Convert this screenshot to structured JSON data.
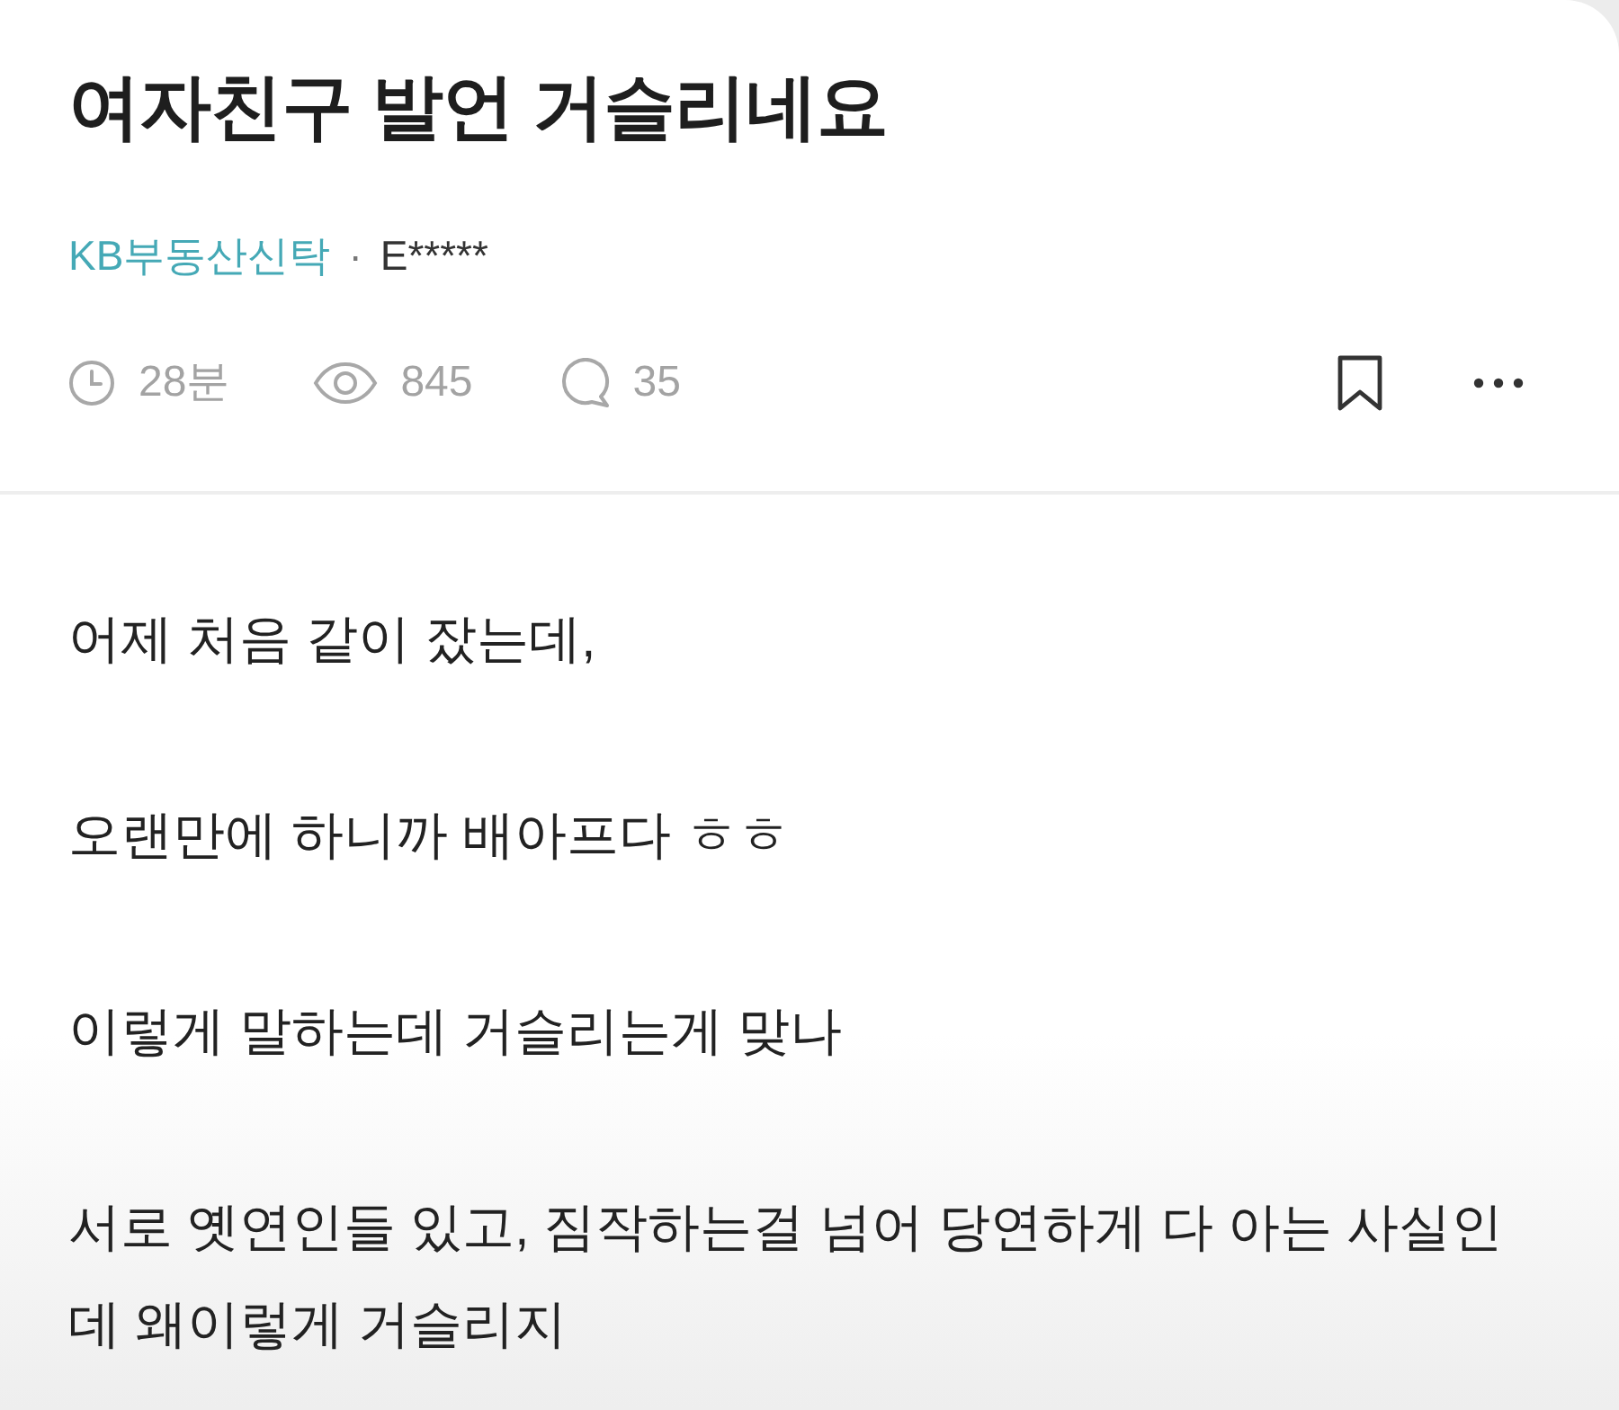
{
  "post": {
    "title": "여자친구 발언 거슬리네요",
    "board": "KB부동산신탁",
    "separator": "·",
    "author": "E*****",
    "stats": [
      {
        "kind": "time",
        "value": "28분"
      },
      {
        "kind": "views",
        "value": "845"
      },
      {
        "kind": "comments",
        "value": "35"
      }
    ],
    "bookmarked": false
  },
  "body": {
    "paragraphs": [
      "어제 처음 같이 잤는데,",
      "오랜만에 하니까 배아프다 ㅎㅎ",
      "이렇게 말하는데 거슬리는게 맞나",
      "서로 옛연인들 있고, 짐작하는걸 넘어 당연하게 다 아는 사실인데 왜이렇게 거슬리지"
    ]
  }
}
